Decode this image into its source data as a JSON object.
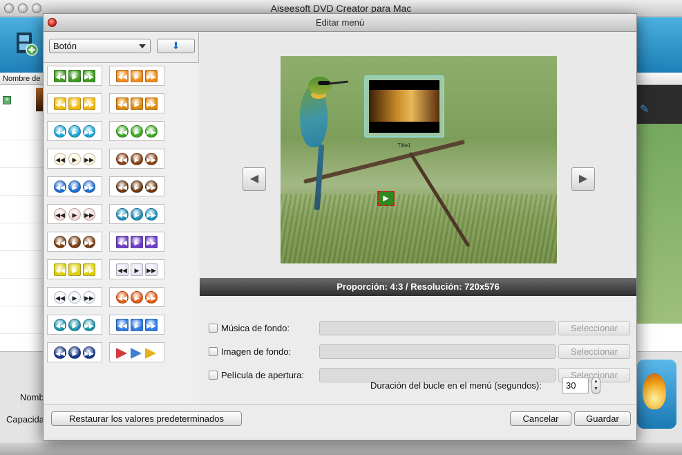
{
  "app": {
    "title": "Aiseesoft DVD Creator para Mac"
  },
  "main": {
    "column_header": "Nombre de",
    "label_name": "Nomb",
    "label_capacity": "Capacida"
  },
  "dialog": {
    "title": "Editar menú",
    "type_select": {
      "value": "Botón"
    },
    "aspect_info": "Proporción: 4:3 / Resolución: 720x576",
    "preview": {
      "title_label": "Title1"
    },
    "settings": {
      "bg_music": {
        "label": "Música de fondo:",
        "button": "Seleccionar"
      },
      "bg_image": {
        "label": "Imagen de fondo:",
        "button": "Seleccionar"
      },
      "opening_film": {
        "label": "Película de apertura:",
        "button": "Seleccionar"
      },
      "loop_duration": {
        "label": "Duración del bucle en el menú (segundos):",
        "value": "30"
      }
    },
    "buttons": {
      "restore": "Restaurar los valores predeterminados",
      "cancel": "Cancelar",
      "save": "Guardar"
    }
  },
  "button_styles": [
    {
      "name": "green-square",
      "color": "#3c9a1f",
      "shape": "square"
    },
    {
      "name": "orange-square",
      "color": "#f08a1a",
      "shape": "square"
    },
    {
      "name": "yellow-square",
      "color": "#f2b90d",
      "shape": "square"
    },
    {
      "name": "amber-square",
      "color": "#e08a0c",
      "shape": "square"
    },
    {
      "name": "cyan-round",
      "color": "#1aa6d8",
      "shape": "round"
    },
    {
      "name": "green-round",
      "color": "#3da923",
      "shape": "round"
    },
    {
      "name": "outline-round",
      "color": "#fff6dc",
      "shape": "round"
    },
    {
      "name": "brown-round",
      "color": "#8a3f12",
      "shape": "round"
    },
    {
      "name": "blue-round",
      "color": "#1f6fd6",
      "shape": "round"
    },
    {
      "name": "brown-round-2",
      "color": "#6f3a12",
      "shape": "round"
    },
    {
      "name": "pink-round",
      "color": "#f3d7d7",
      "shape": "round"
    },
    {
      "name": "teal-round",
      "color": "#1d8fb8",
      "shape": "round"
    },
    {
      "name": "brown-round-3",
      "color": "#7a3d10",
      "shape": "round"
    },
    {
      "name": "purple-square",
      "color": "#6b3ec9",
      "shape": "square"
    },
    {
      "name": "yellow-green-square",
      "color": "#dccf0d",
      "shape": "square"
    },
    {
      "name": "pale-square",
      "color": "#e9e3f6",
      "shape": "square"
    },
    {
      "name": "white-round",
      "color": "#eef3fb",
      "shape": "round"
    },
    {
      "name": "orange-glossy-round",
      "color": "#e25a13",
      "shape": "round"
    },
    {
      "name": "teal-drop",
      "color": "#1b93ad",
      "shape": "round"
    },
    {
      "name": "blue-square",
      "color": "#2f7be3",
      "shape": "square"
    },
    {
      "name": "navy-round",
      "color": "#173a8c",
      "shape": "round"
    },
    {
      "name": "multicolor-arrow",
      "color": "#d23c3c",
      "shape": "arrow"
    }
  ]
}
